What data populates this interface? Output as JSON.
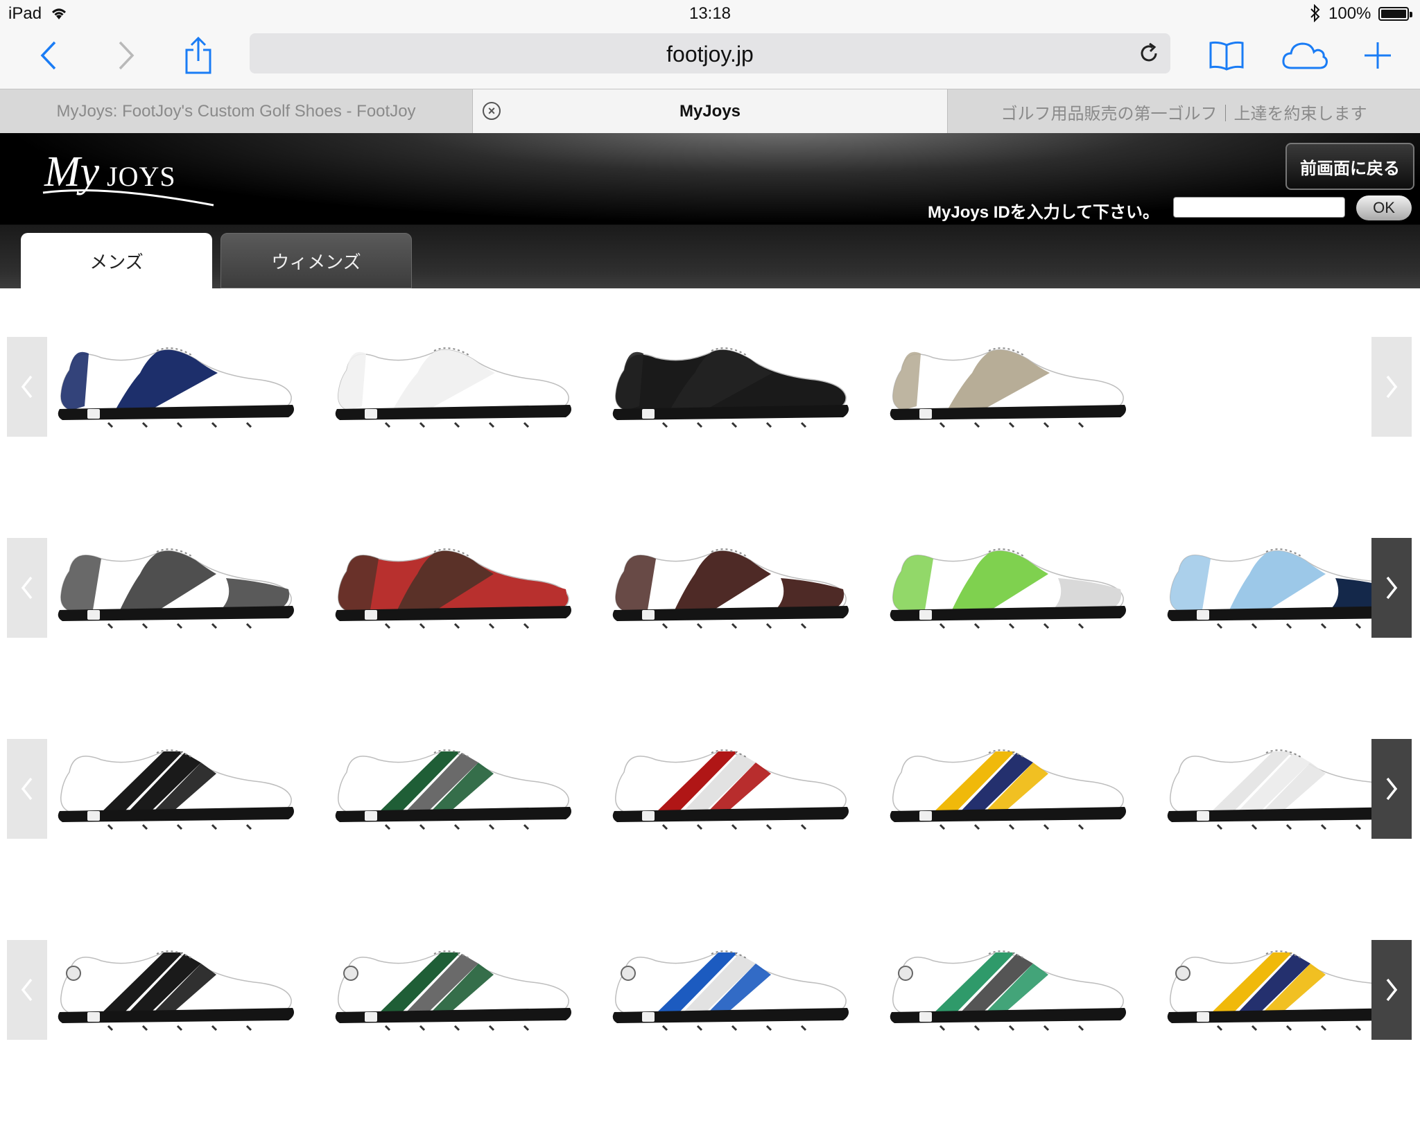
{
  "status_bar": {
    "device": "iPad",
    "time": "13:18",
    "battery": "100%"
  },
  "toolbar": {
    "url_host": "footjoy.jp"
  },
  "tabs": [
    {
      "label": "MyJoys: FootJoy's Custom Golf Shoes - FootJoy"
    },
    {
      "label": "MyJoys"
    },
    {
      "label": "ゴルフ用品販売の第一ゴルフ｜上達を約束します"
    }
  ],
  "header": {
    "logo_text": "MyJoys",
    "back_button": "前画面に戻る",
    "id_label": "MyJoys IDを入力して下さい。",
    "id_input_value": "",
    "ok_button": "OK"
  },
  "categories": [
    {
      "label": "メンズ",
      "active": true
    },
    {
      "label": "ウィメンズ",
      "active": false
    }
  ],
  "shoe_rows": [
    {
      "right_arrow": "light",
      "shoes": [
        {
          "style": "saddle",
          "base": "#ffffff",
          "accent": "#1d2f6b",
          "tip": "#ffffff"
        },
        {
          "style": "saddle",
          "base": "#ffffff",
          "accent": "#f1f1f1",
          "tip": "#ffffff"
        },
        {
          "style": "saddle",
          "base": "#1a1a1a",
          "accent": "#222222",
          "tip": "#1a1a1a"
        },
        {
          "style": "saddle",
          "base": "#ffffff",
          "accent": "#b7ad97",
          "tip": "#ffffff"
        }
      ]
    },
    {
      "right_arrow": "dark",
      "shoes": [
        {
          "style": "wingtip",
          "base": "#ffffff",
          "accent": "#4f4f4f",
          "tip": "#5a5a5a"
        },
        {
          "style": "wingtip",
          "base": "#b8302e",
          "accent": "#5a3128",
          "tip": "#b8302e"
        },
        {
          "style": "wingtip",
          "base": "#ffffff",
          "accent": "#4e2a26",
          "tip": "#4e2a26"
        },
        {
          "style": "wingtip",
          "base": "#ffffff",
          "accent": "#7fd14f",
          "tip": "#d9d9d9"
        },
        {
          "style": "wingtip",
          "base": "#ffffff",
          "accent": "#9cc8e8",
          "tip": "#14284a"
        }
      ]
    },
    {
      "right_arrow": "dark",
      "shoes": [
        {
          "style": "stripe",
          "base": "#ffffff",
          "accent": "#1a1a1a",
          "accent2": "#1a1a1a"
        },
        {
          "style": "stripe",
          "base": "#ffffff",
          "accent": "#1f5e36",
          "accent2": "#6a6a6a"
        },
        {
          "style": "stripe",
          "base": "#ffffff",
          "accent": "#b01616",
          "accent2": "#e2e2e2"
        },
        {
          "style": "stripe",
          "base": "#ffffff",
          "accent": "#f0b90a",
          "accent2": "#24306e"
        },
        {
          "style": "stripe",
          "base": "#ffffff",
          "accent": "#e6e6e6",
          "accent2": "#ededed"
        }
      ]
    },
    {
      "right_arrow": "dark",
      "shoes": [
        {
          "style": "boa",
          "base": "#ffffff",
          "accent": "#1a1a1a",
          "accent2": "#1a1a1a"
        },
        {
          "style": "boa",
          "base": "#ffffff",
          "accent": "#1f5e36",
          "accent2": "#6a6a6a"
        },
        {
          "style": "boa",
          "base": "#ffffff",
          "accent": "#1c5bc0",
          "accent2": "#e2e2e2"
        },
        {
          "style": "boa",
          "base": "#ffffff",
          "accent": "#2f9a6a",
          "accent2": "#555555"
        },
        {
          "style": "boa",
          "base": "#ffffff",
          "accent": "#f0b90a",
          "accent2": "#24306e"
        }
      ]
    }
  ]
}
